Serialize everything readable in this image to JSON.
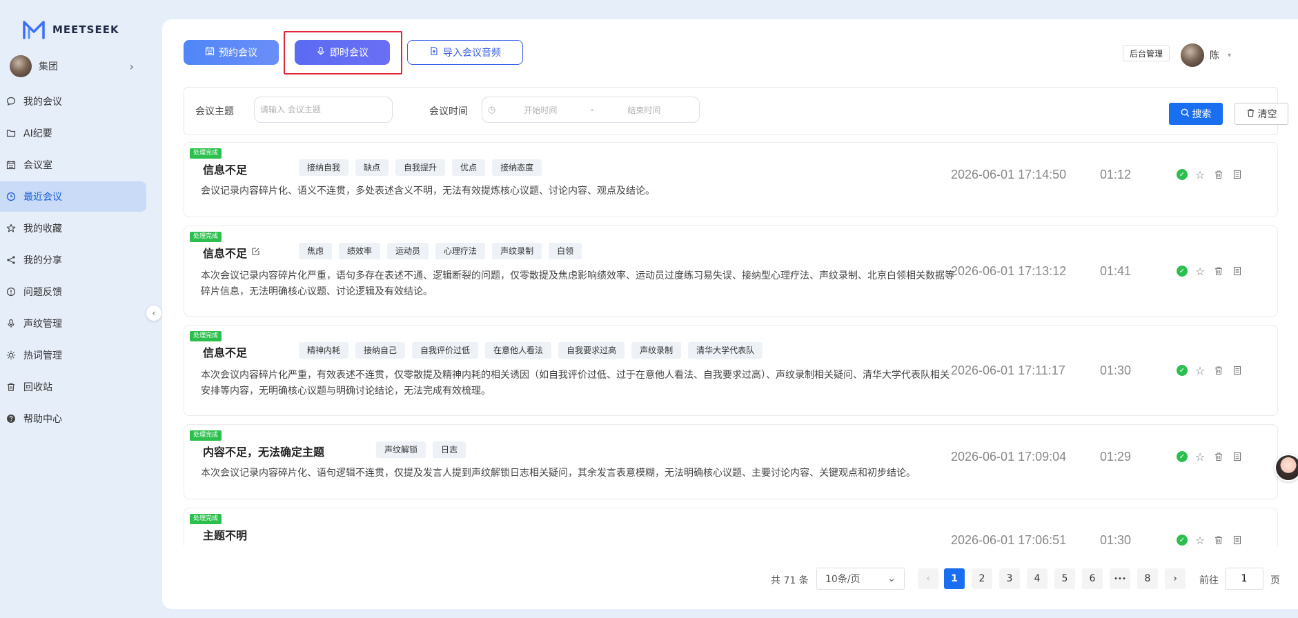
{
  "brand": {
    "name": "MEETSEEK",
    "accent": "#1a6ff0"
  },
  "org": {
    "name": "集团"
  },
  "sidebar": {
    "items": [
      {
        "label": "我的会议",
        "icon": "chat-icon"
      },
      {
        "label": "AI纪要",
        "icon": "folder-icon"
      },
      {
        "label": "会议室",
        "icon": "calendar-icon"
      },
      {
        "label": "最近会议",
        "icon": "clock-icon",
        "active": true
      },
      {
        "label": "我的收藏",
        "icon": "star-icon"
      },
      {
        "label": "我的分享",
        "icon": "share-icon"
      },
      {
        "label": "问题反馈",
        "icon": "alert-icon"
      },
      {
        "label": "声纹管理",
        "icon": "mic-icon"
      },
      {
        "label": "热词管理",
        "icon": "sun-icon"
      },
      {
        "label": "回收站",
        "icon": "trash-icon"
      },
      {
        "label": "帮助中心",
        "icon": "help-icon"
      }
    ]
  },
  "toolbar": {
    "book_label": "预约会议",
    "now_label": "即时会议",
    "import_label": "导入会议音频"
  },
  "header": {
    "admin_label": "后台管理",
    "user_name": "陈"
  },
  "filter": {
    "topic_label": "会议主题",
    "topic_placeholder": "请输入 会议主题",
    "time_label": "会议时间",
    "start_placeholder": "开始时间",
    "range_sep": "-",
    "end_placeholder": "结束时间",
    "search_label": "搜索",
    "clear_label": "清空"
  },
  "meetings": [
    {
      "status": "处理完成",
      "title": "信息不足",
      "editable": false,
      "tags": [
        "接纳自我",
        "缺点",
        "自我提升",
        "优点",
        "接纳态度"
      ],
      "summary": "会议记录内容碎片化、语义不连贯，多处表述含义不明，无法有效提炼核心议题、讨论内容、观点及结论。",
      "time": "2026-06-01 17:14:50",
      "duration": "01:12"
    },
    {
      "status": "处理完成",
      "title": "信息不足",
      "editable": true,
      "tags": [
        "焦虑",
        "绩效率",
        "运动员",
        "心理疗法",
        "声纹录制",
        "白领"
      ],
      "summary": "本次会议记录内容碎片化严重，语句多存在表述不通、逻辑断裂的问题，仅零散提及焦虑影响绩效率、运动员过度练习易失误、接纳型心理疗法、声纹录制、北京白领相关数据等碎片信息，无法明确核心议题、讨论逻辑及有效结论。",
      "time": "2026-06-01 17:13:12",
      "duration": "01:41"
    },
    {
      "status": "处理完成",
      "title": "信息不足",
      "editable": false,
      "tags": [
        "精神内耗",
        "接纳自己",
        "自我评价过低",
        "在意他人看法",
        "自我要求过高",
        "声纹录制",
        "清华大学代表队"
      ],
      "summary": "本次会议内容碎片化严重，有效表述不连贯，仅零散提及精神内耗的相关诱因（如自我评价过低、过于在意他人看法、自我要求过高）、声纹录制相关疑问、清华大学代表队相关安排等内容，无明确核心议题与明确讨论结论，无法完成有效梳理。",
      "time": "2026-06-01 17:11:17",
      "duration": "01:30"
    },
    {
      "status": "处理完成",
      "title": "内容不足，无法确定主题",
      "editable": false,
      "tags": [
        "声纹解锁",
        "日志"
      ],
      "summary": "本次会议记录内容碎片化、语句逻辑不连贯，仅提及发言人提到声纹解锁日志相关疑问，其余发言表意模糊，无法明确核心议题、主要讨论内容、关键观点和初步结论。",
      "time": "2026-06-01 17:09:04",
      "duration": "01:29"
    },
    {
      "status": "处理完成",
      "title": "主题不明",
      "editable": false,
      "tags": [],
      "summary": "",
      "time": "2026-06-01 17:06:51",
      "duration": "01:30"
    }
  ],
  "pagination": {
    "total_label": "共 71 条",
    "page_size_label": "10条/页",
    "prev": "‹",
    "next": "›",
    "pages": [
      "1",
      "2",
      "3",
      "4",
      "5",
      "6",
      "•••",
      "8"
    ],
    "current": "1",
    "goto_label": "前往",
    "goto_value": "1",
    "page_unit": "页"
  }
}
